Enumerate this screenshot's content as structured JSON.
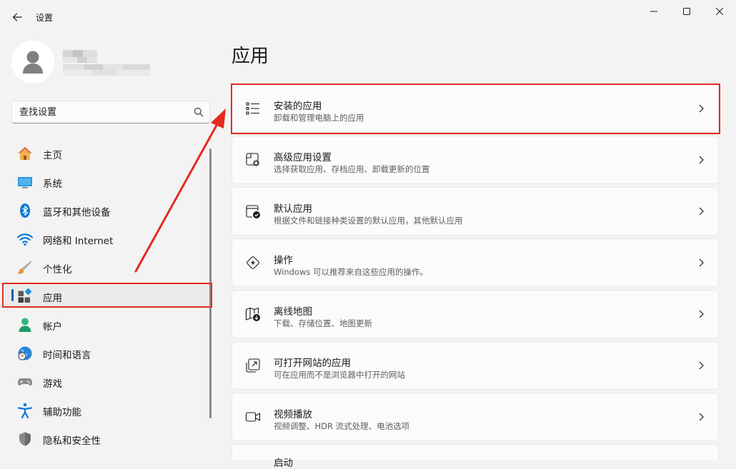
{
  "window": {
    "title": "设置",
    "controls": [
      "minimize",
      "maximize",
      "close"
    ]
  },
  "profile": {
    "name": "",
    "email": ""
  },
  "search": {
    "placeholder": "查找设置"
  },
  "sidebar": {
    "items": [
      {
        "label": "主页",
        "icon": "home-icon",
        "selected": false
      },
      {
        "label": "系统",
        "icon": "system-icon",
        "selected": false
      },
      {
        "label": "蓝牙和其他设备",
        "icon": "bluetooth-icon",
        "selected": false
      },
      {
        "label": "网络和 Internet",
        "icon": "wifi-icon",
        "selected": false
      },
      {
        "label": "个性化",
        "icon": "brush-icon",
        "selected": false
      },
      {
        "label": "应用",
        "icon": "apps-icon",
        "selected": true
      },
      {
        "label": "帐户",
        "icon": "account-icon",
        "selected": false
      },
      {
        "label": "时间和语言",
        "icon": "clock-globe-icon",
        "selected": false
      },
      {
        "label": "游戏",
        "icon": "gamepad-icon",
        "selected": false
      },
      {
        "label": "辅助功能",
        "icon": "accessibility-icon",
        "selected": false
      },
      {
        "label": "隐私和安全性",
        "icon": "shield-icon",
        "selected": false
      }
    ]
  },
  "main": {
    "title": "应用",
    "cards": [
      {
        "title": "安装的应用",
        "subtitle": "卸载和管理电脑上的应用",
        "icon": "list-icon"
      },
      {
        "title": "高级应用设置",
        "subtitle": "选择获取应用、存档应用、卸载更新的位置",
        "icon": "app-settings-icon"
      },
      {
        "title": "默认应用",
        "subtitle": "根据文件和链接种类设置的默认应用，其他默认应用",
        "icon": "default-apps-icon"
      },
      {
        "title": "操作",
        "subtitle": "Windows 可以推荐来自这些应用的操作。",
        "icon": "actions-icon"
      },
      {
        "title": "离线地图",
        "subtitle": "下载、存储位置、地图更新",
        "icon": "offline-map-icon"
      },
      {
        "title": "可打开网站的应用",
        "subtitle": "可在应用而不是浏览器中打开的网站",
        "icon": "open-website-icon"
      },
      {
        "title": "视频播放",
        "subtitle": "视频调整、HDR 流式处理、电池选项",
        "icon": "video-icon"
      },
      {
        "title": "启动",
        "subtitle": "",
        "icon": "startup-icon"
      }
    ]
  },
  "colors": {
    "accent": "#005fb8",
    "annotation": "#e52a1e",
    "background": "#f3f3f3",
    "card": "#fbfbfb"
  }
}
